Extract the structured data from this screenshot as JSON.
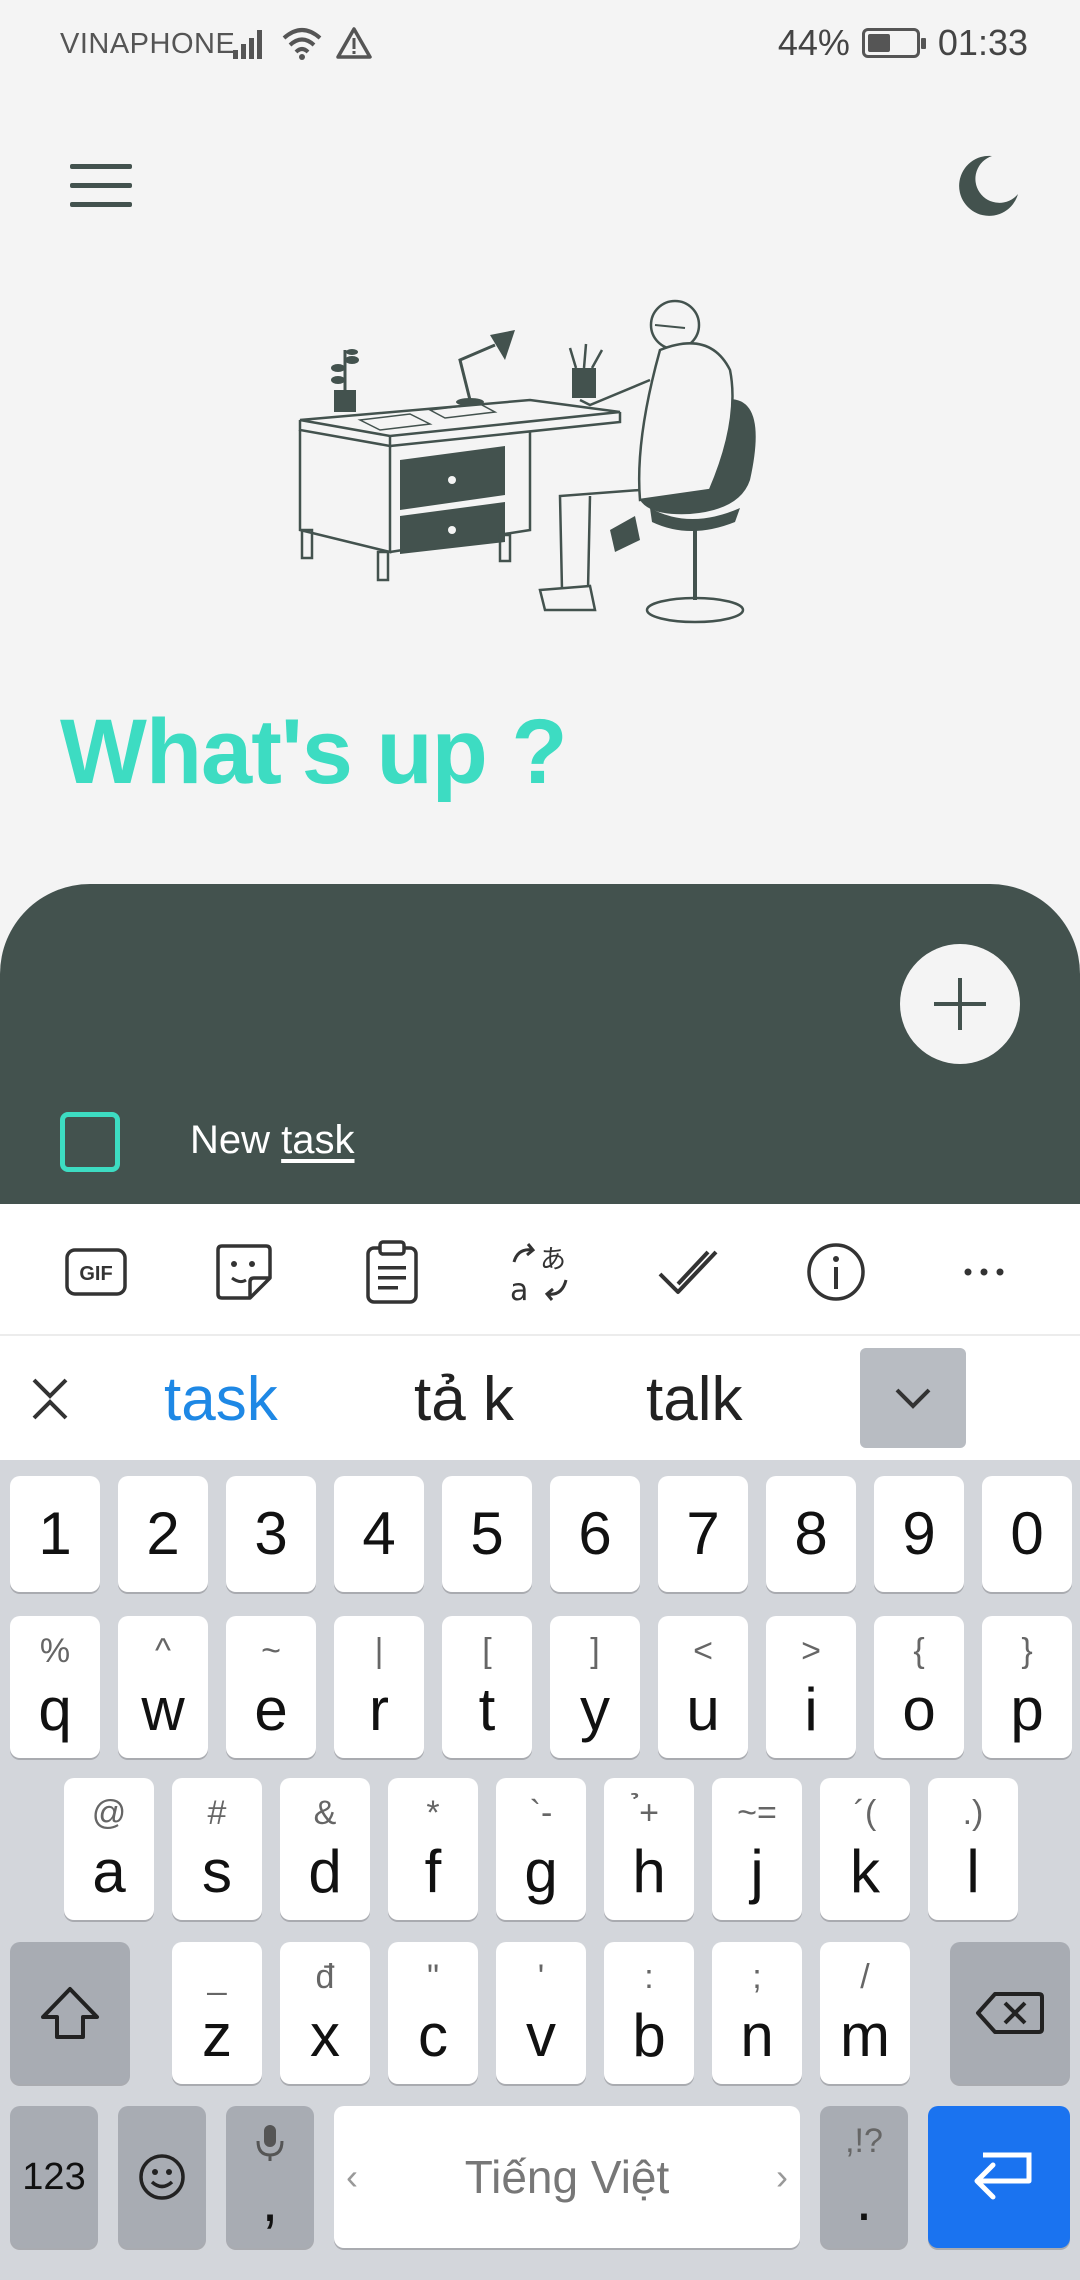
{
  "status_bar": {
    "carrier": "VINAPHONE",
    "battery": "44%",
    "time": "01:33"
  },
  "app": {
    "headline": "What's up ?",
    "new_task_prefix": "New ",
    "new_task_word": "task",
    "accent_color": "#3ddcc2",
    "panel_color": "#43524e"
  },
  "keyboard_toolbar": {
    "gif_label": "GIF",
    "items": [
      "gif-icon",
      "sticker-icon",
      "clipboard-icon",
      "translate-icon",
      "check-icon",
      "info-icon",
      "more-icon"
    ]
  },
  "suggestions": [
    "task",
    "tả k",
    "talk"
  ],
  "keyboard": {
    "numbers": [
      "1",
      "2",
      "3",
      "4",
      "5",
      "6",
      "7",
      "8",
      "9",
      "0"
    ],
    "row1": [
      {
        "main": "q",
        "sub": "%"
      },
      {
        "main": "w",
        "sub": "^"
      },
      {
        "main": "e",
        "sub": "~"
      },
      {
        "main": "r",
        "sub": "|"
      },
      {
        "main": "t",
        "sub": "["
      },
      {
        "main": "y",
        "sub": "]"
      },
      {
        "main": "u",
        "sub": "<"
      },
      {
        "main": "i",
        "sub": ">"
      },
      {
        "main": "o",
        "sub": "{"
      },
      {
        "main": "p",
        "sub": "}"
      }
    ],
    "row2": [
      {
        "main": "a",
        "sub": "@"
      },
      {
        "main": "s",
        "sub": "#"
      },
      {
        "main": "d",
        "sub": "&"
      },
      {
        "main": "f",
        "sub": "*"
      },
      {
        "main": "g",
        "sub": "`-"
      },
      {
        "main": "h",
        "sub": "̉+"
      },
      {
        "main": "j",
        "sub": "~="
      },
      {
        "main": "k",
        "sub": "´("
      },
      {
        "main": "l",
        "sub": ".)"
      }
    ],
    "row3": [
      {
        "main": "z",
        "sub": "_"
      },
      {
        "main": "x",
        "sub": "đ"
      },
      {
        "main": "c",
        "sub": "\""
      },
      {
        "main": "v",
        "sub": "'"
      },
      {
        "main": "b",
        "sub": ":"
      },
      {
        "main": "n",
        "sub": ";"
      },
      {
        "main": "m",
        "sub": "/"
      }
    ],
    "mode_key": "123",
    "comma_key": ",",
    "space_label": "Tiếng Việt",
    "period_key": ".",
    "period_sub": ",!?"
  }
}
